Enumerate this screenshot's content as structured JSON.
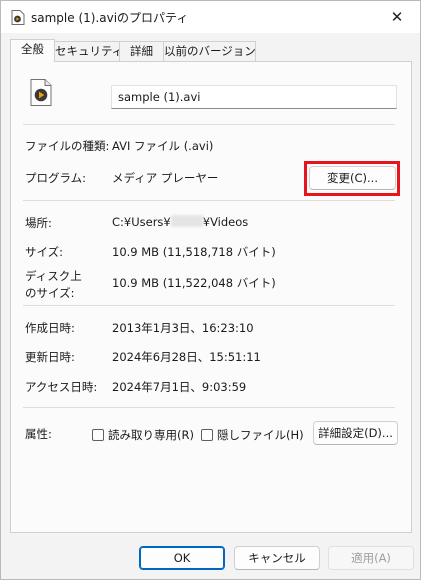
{
  "window": {
    "title": "sample (1).aviのプロパティ",
    "close_glyph": "✕"
  },
  "tabs": [
    {
      "label": "全般",
      "active": true
    },
    {
      "label": "セキュリティ",
      "active": false
    },
    {
      "label": "詳細",
      "active": false
    },
    {
      "label": "以前のバージョン",
      "active": false
    }
  ],
  "general": {
    "file_name": "sample (1).avi",
    "file_type_label": "ファイルの種類:",
    "file_type_value": "AVI ファイル (.avi)",
    "program_label": "プログラム:",
    "program_value": "メディア プレーヤー",
    "change_button": "変更(C)...",
    "location_label": "場所:",
    "location_prefix": "C:¥Users¥",
    "location_suffix": "¥Videos",
    "size_label": "サイズ:",
    "size_value": "10.9 MB (11,518,718 バイト)",
    "disk_size_label_1": "ディスク上",
    "disk_size_label_2": "のサイズ:",
    "disk_size_value": "10.9 MB (11,522,048 バイト)",
    "created_label": "作成日時:",
    "created_value": "2013年1月3日、16:23:10",
    "modified_label": "更新日時:",
    "modified_value": "2024年6月28日、15:51:11",
    "accessed_label": "アクセス日時:",
    "accessed_value": "2024年7月1日、9:03:59",
    "attributes_label": "属性:",
    "readonly_label": "読み取り専用(R)",
    "readonly_checked": false,
    "hidden_label": "隠しファイル(H)",
    "hidden_checked": false,
    "advanced_button": "詳細設定(D)..."
  },
  "footer": {
    "ok": "OK",
    "cancel": "キャンセル",
    "apply": "適用(A)",
    "apply_enabled": false
  },
  "colors": {
    "highlight": "#e8141b",
    "accent": "#0067c0"
  }
}
